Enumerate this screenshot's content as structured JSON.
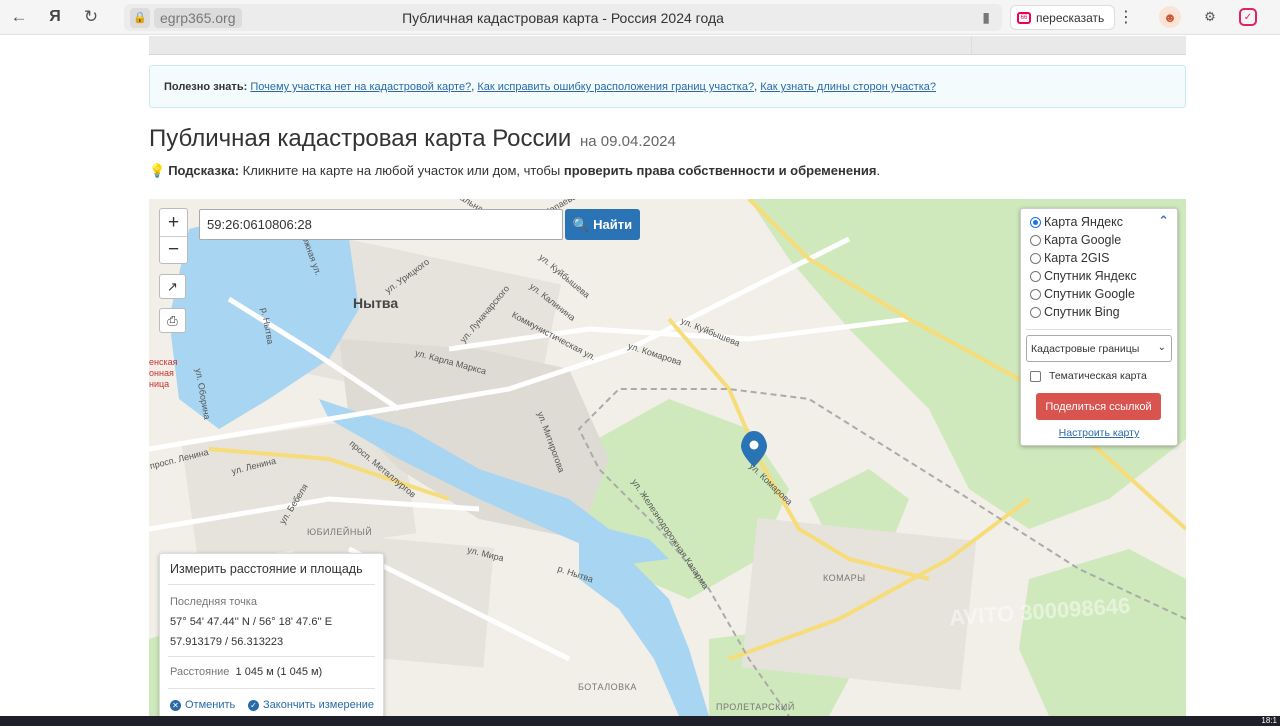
{
  "browser": {
    "domain": "egrp365.org",
    "page_title": "Публичная кадастровая карта - Россия 2024 года",
    "retell_label": "пересказать"
  },
  "info": {
    "label": "Полезно знать:",
    "links": [
      "Почему участка нет на кадастровой карте?",
      "Как исправить ошибку расположения границ участка?",
      "Как узнать длины сторон участка?"
    ]
  },
  "heading": {
    "title": "Публичная кадастровая карта России",
    "date": "на 09.04.2024"
  },
  "hint": {
    "label": "Подсказка:",
    "text": " Кликните на карте на любой участок или дом, чтобы ",
    "bold": "проверить права собственности и обременения",
    "end": "."
  },
  "map": {
    "zoom_in": "+",
    "zoom_out": "−",
    "search_value": "59:26:0610806:28",
    "search_button": "Найти",
    "labels": {
      "nytva": "Нытва",
      "kachal": "ачальная ул.",
      "ul_chapaeva": "ул. Чапаева",
      "yuzhnaya": "Южная ул.",
      "ul_uritskogo": "ул. Урицкого",
      "ul_kuibysheva": "ул. Куйбышева",
      "ul_kalinina": "ул. Калинина",
      "ul_kuibysheva2": "ул. Куйбышева",
      "ul_lunacharskogo": "ул. Луначарского",
      "kommunisticheskaya": "Коммунистическая ул.",
      "ul_komarova": "ул. Комарова",
      "ul_karla_marksa": "ул. Карла Маркса",
      "r_nytva": "р. Нытва",
      "r_nytva2": "р. Нытва",
      "ul_oborina": "ул. Оборина",
      "prosp_lenina": "просп. Ленина",
      "ul_lenina": "ул. Ленина",
      "prosp_metallurgov": "просп. Металлургов",
      "ul_mitinoroga": "ул. Митирогова",
      "ul_zheleznodorozhnaya": "ул. Железнодорожная Казарма",
      "ul_komarova2": "ул. Комарова",
      "ul_bebelya": "ул. Бебеля",
      "yubileiny": "ЮБИЛЕЙНЫЙ",
      "ul_mira": "ул. Мира",
      "komary": "КОМАРЫ",
      "botalovka": "БОТАЛОВКА",
      "proletarsky": "ПРОЛЕТАРСКИЙ",
      "hospital": "енская\nонная\nница",
      "watermark": "AVITO 300098646"
    }
  },
  "layers": {
    "options": [
      "Карта Яндекс",
      "Карта Google",
      "Карта 2GIS",
      "Спутник Яндекс",
      "Спутник Google",
      "Спутник Bing"
    ],
    "selected": "Карта Яндекс",
    "overlay_select": "Кадастровые границы",
    "thematic": "Тематическая карта",
    "share": "Поделиться ссылкой",
    "configure": "Настроить карту"
  },
  "measure": {
    "title": "Измерить расстояние и площадь",
    "last_point_label": "Последняя точка",
    "coords_dms": "57° 54' 47.44'' N / 56° 18' 47.6'' E",
    "coords_dec": "57.913179 / 56.313223",
    "distance_label": "Расстояние",
    "distance_value": "1 045 м (1 045 м)",
    "cancel": "Отменить",
    "finish": "Закончить измерение"
  },
  "taskbar": {
    "clock": "18:1"
  },
  "colors": {
    "accent": "#2a74b5",
    "danger": "#d9534f",
    "water": "#a8d5f2",
    "forest": "#cfe9bd"
  }
}
